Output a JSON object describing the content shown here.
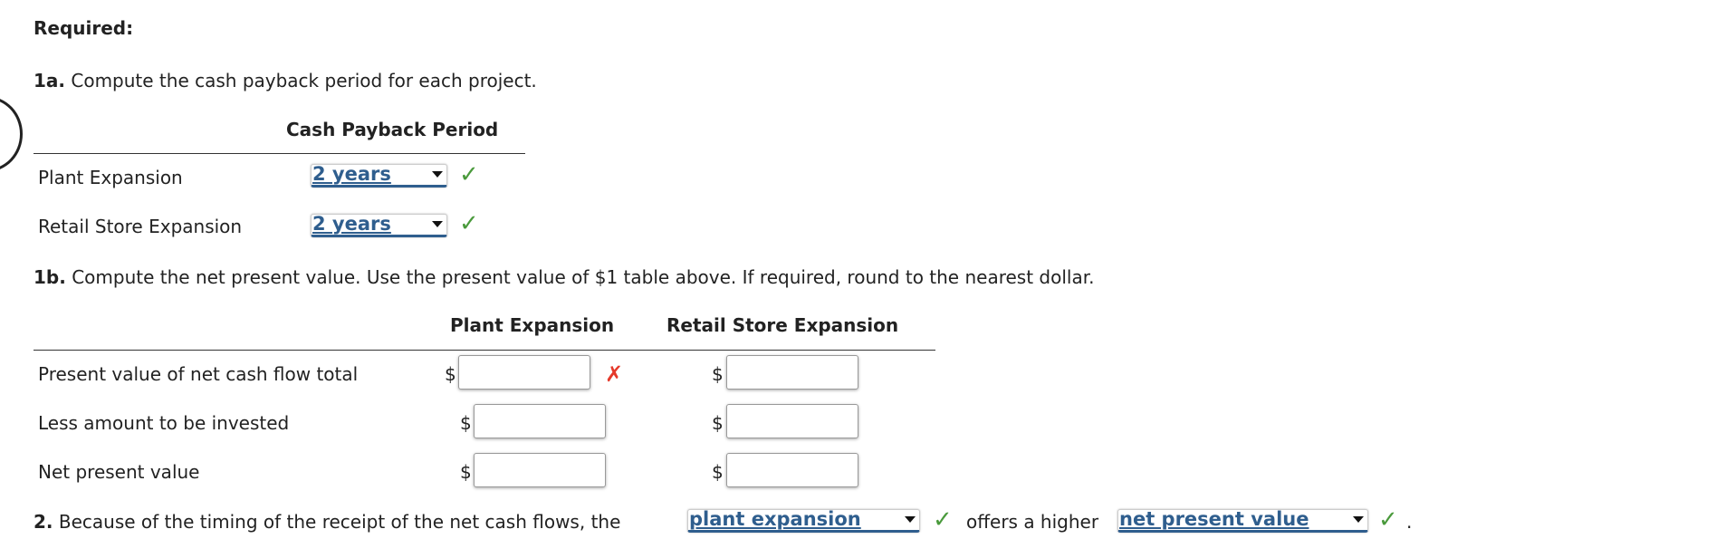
{
  "required_label": "Required:",
  "q1a": {
    "number": "1a.",
    "text": "Compute the cash payback period for each project.",
    "column_header": "Cash Payback Period",
    "rows": [
      {
        "label": "Plant Expansion",
        "value": "2 years",
        "status": "correct"
      },
      {
        "label": "Retail Store Expansion",
        "value": "2 years",
        "status": "correct"
      }
    ]
  },
  "q1b": {
    "number": "1b.",
    "text": "Compute the net present value. Use the present value of $1 table above. If required, round to the nearest dollar.",
    "headers": [
      "Plant Expansion",
      "Retail Store Expansion"
    ],
    "currency": "$",
    "rows": [
      {
        "label": "Present value of net cash flow total",
        "plant": "",
        "retail": "",
        "plant_status": "incorrect"
      },
      {
        "label": "Less amount to be invested",
        "plant": "",
        "retail": ""
      },
      {
        "label": "Net present value",
        "plant": "",
        "retail": ""
      }
    ]
  },
  "q2": {
    "number": "2.",
    "text_before": "Because of the timing of the receipt of the net cash flows, the",
    "select1": "plant expansion",
    "text_middle": "offers a higher",
    "select2": "net present value",
    "text_end": "."
  },
  "icons": {
    "correct": "✓",
    "incorrect": "✗"
  },
  "colors": {
    "select_text": "#2f5e8e",
    "correct": "#4a9a3c",
    "incorrect": "#e53a2b"
  }
}
